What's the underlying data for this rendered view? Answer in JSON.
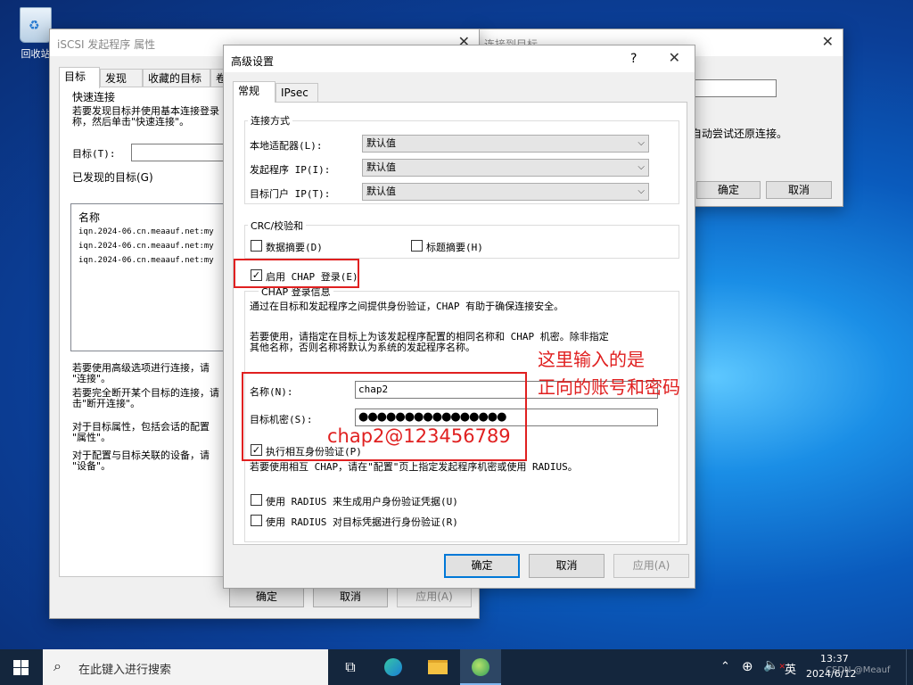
{
  "desktop": {
    "recycle_bin": "回收站"
  },
  "iscsi_window": {
    "title": "iSCSI 发起程序 属性",
    "tabs": [
      "目标",
      "发现",
      "收藏的目标",
      "卷"
    ],
    "quick_connect": {
      "group": "快速连接",
      "desc1": "若要发现目标并使用基本连接登录",
      "desc2": "称，然后单击\"快速连接\"。",
      "target_label": "目标(T):"
    },
    "discovered": {
      "group": "已发现的目标(G)",
      "column": "名称",
      "rows": [
        "iqn.2024-06.cn.meaauf.net:my",
        "iqn.2024-06.cn.meaauf.net:my",
        "iqn.2024-06.cn.meaauf.net:my"
      ]
    },
    "help": [
      "若要使用高级选项进行连接，请",
      "\"连接\"。",
      "若要完全断开某个目标的连接，请",
      "击\"断开连接\"。",
      "对于目标属性，包括会话的配置",
      "\"属性\"。",
      "对于配置与目标关联的设备，请",
      "\"设备\"。"
    ],
    "buttons": {
      "ok": "确定",
      "cancel": "取消",
      "apply": "应用(A)"
    }
  },
  "connect_window": {
    "title": "连接到目标",
    "text": "自动尝试还原连接。",
    "buttons": {
      "ok": "确定",
      "cancel": "取消"
    }
  },
  "adv_dialog": {
    "title": "高级设置",
    "help": "?",
    "tabs": [
      "常规",
      "IPsec"
    ],
    "conn": {
      "group": "连接方式",
      "local_adapter": {
        "label": "本地适配器(L):",
        "value": "默认值"
      },
      "initiator_ip": {
        "label": "发起程序 IP(I):",
        "value": "默认值"
      },
      "portal_ip": {
        "label": "目标门户 IP(T):",
        "value": "默认值"
      }
    },
    "crc": {
      "group": "CRC/校验和",
      "data_digest": "数据摘要(D)",
      "header_digest": "标题摘要(H)"
    },
    "chap": {
      "enable": "启用 CHAP 登录(E)",
      "group": "CHAP 登录信息",
      "desc1": "通过在目标和发起程序之间提供身份验证，CHAP 有助于确保连接安全。",
      "desc2": "若要使用，请指定在目标上为该发起程序配置的相同名称和 CHAP 机密。除非指定",
      "desc3": "其他名称，否则名称将默认为系统的发起程序名称。",
      "name_label": "名称(N):",
      "name_value": "chap2",
      "secret_label": "目标机密(S):",
      "secret_value": "●●●●●●●●●●●●●●●●",
      "mutual": "执行相互身份验证(P)",
      "mutual_desc": "若要使用相互 CHAP，请在\"配置\"页上指定发起程序机密或使用 RADIUS。",
      "radius1": "使用 RADIUS 来生成用户身份验证凭据(U)",
      "radius2": "使用 RADIUS 对目标凭据进行身份验证(R)"
    },
    "buttons": {
      "ok": "确定",
      "cancel": "取消",
      "apply": "应用(A)"
    }
  },
  "annotations": {
    "line1": "这里输入的是",
    "line2": "正向的账号和密码",
    "creds": "chap2@123456789"
  },
  "taskbar": {
    "search_placeholder": "在此键入进行搜索",
    "time": "13:37",
    "date": "2024/6/12",
    "ime": "英",
    "watermark": "CSDN @Meauf"
  },
  "colors": {
    "accent": "#0078d7",
    "annotation": "#e02020",
    "taskbar": "#14263d"
  }
}
